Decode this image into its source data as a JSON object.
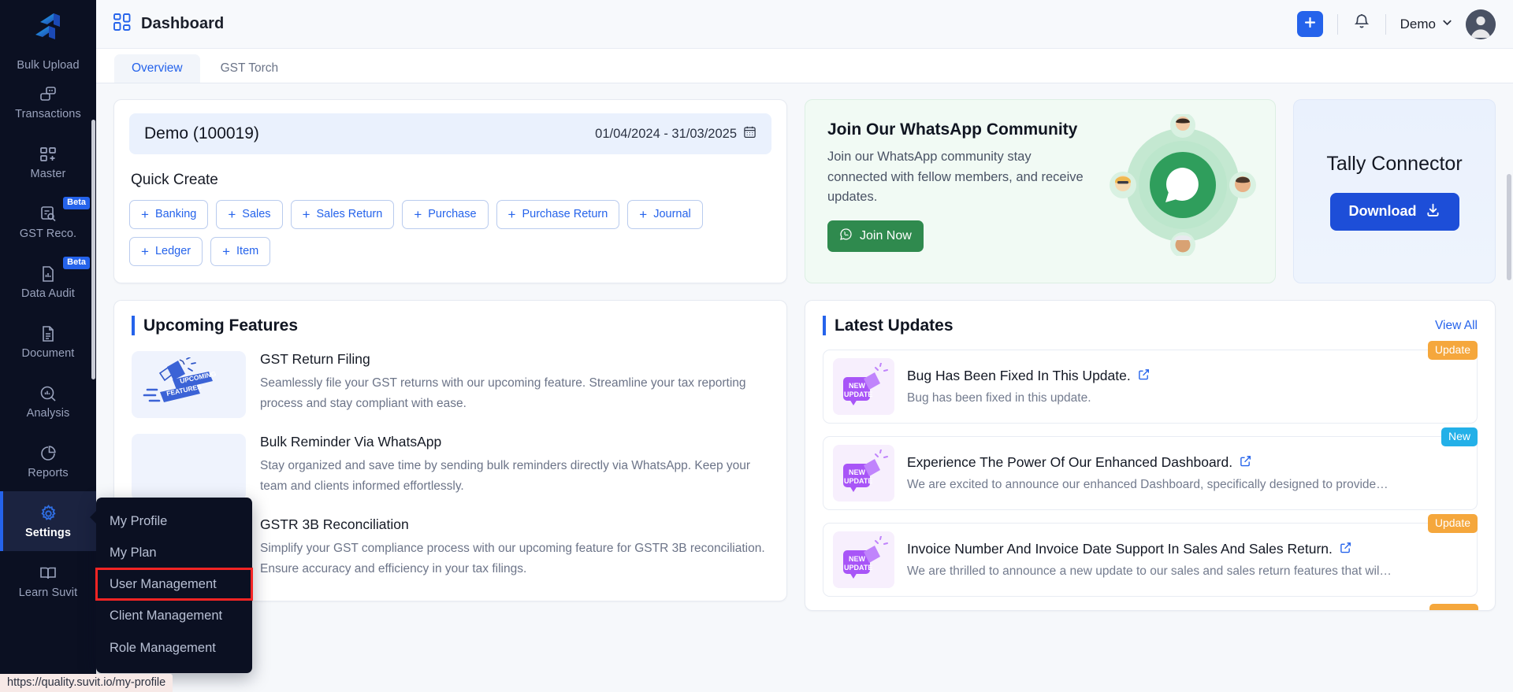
{
  "sidebar": {
    "logo_name": "suvit-logo",
    "items": [
      {
        "label": "Bulk Upload",
        "icon": "upload-icon",
        "badge": "",
        "active": false,
        "partial": true
      },
      {
        "label": "Transactions",
        "icon": "transactions-icon",
        "badge": "",
        "active": false
      },
      {
        "label": "Master",
        "icon": "master-grid-plus-icon",
        "badge": "",
        "active": false
      },
      {
        "label": "GST Reco.",
        "icon": "gst-reco-icon",
        "badge": "Beta",
        "active": false
      },
      {
        "label": "Data Audit",
        "icon": "data-audit-icon",
        "badge": "Beta",
        "active": false
      },
      {
        "label": "Document",
        "icon": "document-icon",
        "badge": "",
        "active": false
      },
      {
        "label": "Analysis",
        "icon": "analysis-icon",
        "badge": "",
        "active": false
      },
      {
        "label": "Reports",
        "icon": "reports-pie-icon",
        "badge": "",
        "active": false
      },
      {
        "label": "Settings",
        "icon": "gear-icon",
        "badge": "",
        "active": true
      },
      {
        "label": "Learn Suvit",
        "icon": "book-icon",
        "badge": "",
        "active": false
      }
    ]
  },
  "header": {
    "title": "Dashboard",
    "title_icon": "dashboard-grid-icon",
    "add_icon": "plus-icon",
    "bell_icon": "bell-icon",
    "user_label": "Demo",
    "chevron_icon": "chevron-down-icon",
    "avatar_icon": "user-avatar"
  },
  "tabs": [
    {
      "label": "Overview",
      "active": true
    },
    {
      "label": "GST Torch",
      "active": false
    }
  ],
  "quick_create": {
    "org_name": "Demo (100019)",
    "date_range": "01/04/2024 - 31/03/2025",
    "calendar_icon": "calendar-icon",
    "section_title": "Quick Create",
    "buttons": [
      {
        "label": "Banking"
      },
      {
        "label": "Sales"
      },
      {
        "label": "Sales Return"
      },
      {
        "label": "Purchase"
      },
      {
        "label": "Purchase Return"
      },
      {
        "label": "Journal"
      },
      {
        "label": "Ledger"
      },
      {
        "label": "Item"
      }
    ]
  },
  "whatsapp": {
    "title": "Join Our WhatsApp Community",
    "description": "Join our WhatsApp community stay connected with fellow members, and receive updates.",
    "button_label": "Join Now",
    "button_icon": "whatsapp-icon",
    "art_icon": "whatsapp-community-illustration",
    "accent_color": "#2f8a4e"
  },
  "tally": {
    "title": "Tally Connector",
    "button_label": "Download",
    "button_icon": "download-icon",
    "accent_color": "#1d4ed8"
  },
  "upcoming_features": {
    "section_title": "Upcoming Features",
    "items": [
      {
        "name": "GST Return Filing",
        "description": "Seamlessly file your GST returns with our upcoming feature. Streamline your tax reporting process and stay compliant with ease.",
        "thumb": "upcoming-features-megaphone"
      },
      {
        "name": "Bulk Reminder Via WhatsApp",
        "description": "Stay organized and save time by sending bulk reminders directly via WhatsApp. Keep your team and clients informed effortlessly.",
        "thumb": "upcoming-features-megaphone"
      },
      {
        "name": "GSTR 3B Reconciliation",
        "description": "Simplify your GST compliance process with our upcoming feature for GSTR 3B reconciliation. Ensure accuracy and efficiency in your tax filings.",
        "thumb": "upcoming-features-megaphone"
      }
    ]
  },
  "latest_updates": {
    "section_title": "Latest Updates",
    "view_all_label": "View All",
    "items": [
      {
        "title": "Bug Has Been Fixed In This Update.",
        "description": "Bug has been fixed in this update.",
        "badge": "Update",
        "badge_type": "update",
        "thumb": "new-update-megaphone",
        "link_icon": "external-link-icon"
      },
      {
        "title": "Experience The Power Of Our Enhanced Dashboard.",
        "description": "We are excited to announce our enhanced Dashboard, specifically designed to provide…",
        "badge": "New",
        "badge_type": "new",
        "thumb": "new-update-megaphone",
        "link_icon": "external-link-icon"
      },
      {
        "title": "Invoice Number And Invoice Date Support In Sales And Sales Return.",
        "description": "We are thrilled to announce a new update to our sales and sales return features that wil…",
        "badge": "Update",
        "badge_type": "update",
        "thumb": "new-update-megaphone",
        "link_icon": "external-link-icon"
      }
    ]
  },
  "context_menu": {
    "items": [
      {
        "label": "My Profile",
        "highlighted": false
      },
      {
        "label": "My Plan",
        "highlighted": false
      },
      {
        "label": "User Management",
        "highlighted": true
      },
      {
        "label": "Client Management",
        "highlighted": false
      },
      {
        "label": "Role Management",
        "highlighted": false
      }
    ],
    "highlight_color": "#f52424"
  },
  "status_bar": {
    "url": "https://quality.suvit.io/my-profile"
  },
  "colors": {
    "sidebar_bg": "#0b1022",
    "primary": "#2563eb",
    "badge_update": "#f5a73c",
    "badge_new": "#23b0e8",
    "whatsapp_green": "#2f8a4e"
  }
}
